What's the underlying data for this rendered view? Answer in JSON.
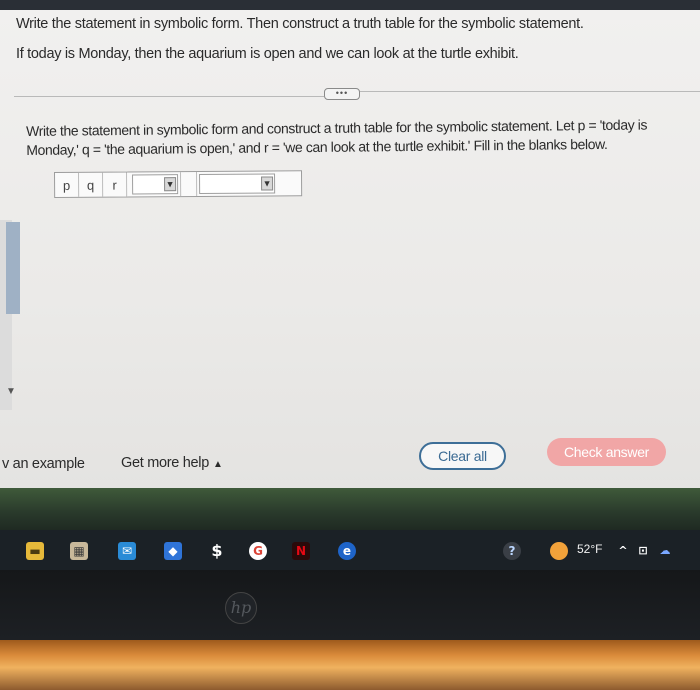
{
  "question": {
    "title": "Write the statement in symbolic form. Then construct a truth table for the symbolic statement.",
    "statement": "If today is Monday, then the aquarium is open and we can look at the turtle exhibit.",
    "expand_label": "•••",
    "instructions": "Write the statement in symbolic form and construct a truth table for the symbolic statement. Let p = 'today is Monday,' q = 'the aquarium is open,' and r = 'we can look at the turtle exhibit.' Fill in the blanks below."
  },
  "truth_table": {
    "headers": [
      "p",
      "q",
      "r"
    ]
  },
  "footer": {
    "example_label": "v an example",
    "help_label": "Get more help",
    "clear_label": "Clear all",
    "check_label": "Check answer"
  },
  "taskbar": {
    "temperature": "52°F"
  },
  "colors": {
    "accent_blue": "#3d6e97",
    "check_disabled": "#f1a6a6"
  },
  "icons": [
    "file-explorer-icon",
    "calendar-icon",
    "mail-icon",
    "dropbox-icon",
    "money-icon",
    "google-chrome-icon",
    "netflix-icon",
    "edge-icon",
    "help-icon",
    "weather-icon",
    "chevron-up-icon",
    "network-icon",
    "cloud-icon"
  ]
}
